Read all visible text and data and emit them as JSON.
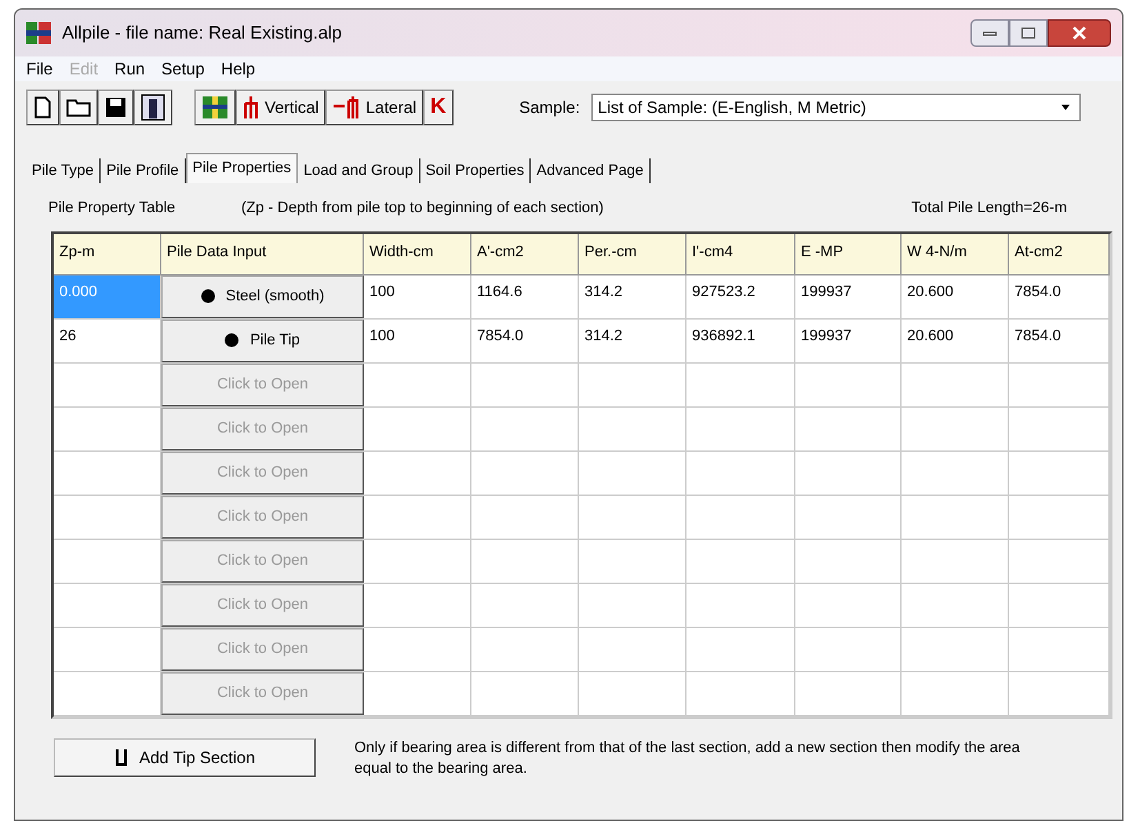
{
  "window": {
    "title": "Allpile - file name: Real Existing.alp"
  },
  "menu": [
    {
      "label": "File",
      "disabled": false
    },
    {
      "label": "Edit",
      "disabled": true
    },
    {
      "label": "Run",
      "disabled": false
    },
    {
      "label": "Setup",
      "disabled": false
    },
    {
      "label": "Help",
      "disabled": false
    }
  ],
  "toolbar": [
    {
      "kind": "new"
    },
    {
      "kind": "open"
    },
    {
      "kind": "save"
    },
    {
      "kind": "pile"
    },
    {
      "kind": "grid"
    },
    {
      "kind": "vertical",
      "label": "Vertical"
    },
    {
      "kind": "lateral",
      "label": "Lateral"
    },
    {
      "kind": "k",
      "label": "K"
    }
  ],
  "sample": {
    "label": "Sample:",
    "value": "List of Sample: (E-English, M Metric)"
  },
  "tabs": [
    {
      "label": "Pile Type",
      "selected": false
    },
    {
      "label": "Pile Profile",
      "selected": false
    },
    {
      "label": "Pile Properties",
      "selected": true
    },
    {
      "label": "Load and Group",
      "selected": false
    },
    {
      "label": "Soil Properties",
      "selected": false
    },
    {
      "label": "Advanced Page",
      "selected": false
    }
  ],
  "table_title": "Pile Property Table",
  "note": "(Zp - Depth from pile top to beginning of each section)",
  "total": "Total Pile Length=26-m",
  "columns": [
    "Zp-m",
    "Pile Data Input",
    "Width-cm",
    "A'-cm2",
    "Per.-cm",
    "I'-cm4",
    "E -MP",
    "W 4-N/m",
    "At-cm2"
  ],
  "rows": [
    {
      "zp": "0.000",
      "selected": true,
      "input": {
        "label": "Steel (smooth)",
        "disabled": false
      },
      "cells": [
        "100",
        "1164.6",
        "314.2",
        "927523.2",
        "199937",
        "20.600",
        "7854.0"
      ]
    },
    {
      "zp": "26",
      "selected": false,
      "input": {
        "label": "Pile Tip",
        "disabled": false
      },
      "cells": [
        "100",
        "7854.0",
        "314.2",
        "936892.1",
        "199937",
        "20.600",
        "7854.0"
      ]
    },
    {
      "input": {
        "label": "Click to Open",
        "disabled": true
      }
    },
    {
      "input": {
        "label": "Click to Open",
        "disabled": true
      }
    },
    {
      "input": {
        "label": "Click to Open",
        "disabled": true
      }
    },
    {
      "input": {
        "label": "Click to Open",
        "disabled": true
      }
    },
    {
      "input": {
        "label": "Click to Open",
        "disabled": true
      }
    },
    {
      "input": {
        "label": "Click to Open",
        "disabled": true
      }
    },
    {
      "input": {
        "label": "Click to Open",
        "disabled": true
      }
    },
    {
      "input": {
        "label": "Click to Open",
        "disabled": true
      }
    }
  ],
  "footer": {
    "button": "Add Tip Section",
    "hint": "Only if bearing area is different from that of the last section, add a new section then modify the area equal to the bearing area."
  }
}
